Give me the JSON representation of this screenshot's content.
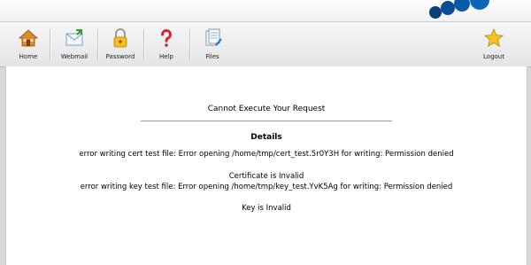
{
  "toolbar": {
    "home_label": "Home",
    "webmail_label": "Webmail",
    "password_label": "Password",
    "help_label": "Help",
    "files_label": "Files",
    "logout_label": "Logout"
  },
  "icons": {
    "home": "house-icon",
    "webmail": "mail-icon",
    "password": "padlock-icon",
    "help": "question-mark-icon",
    "files": "files-icon",
    "logout": "star-icon"
  },
  "colors": {
    "brand_blue": "#0a66b7",
    "content_bg": "#ffffff",
    "toolbar_bg": "#ececec"
  },
  "main": {
    "title": "Cannot Execute Your Request",
    "details_heading": "Details",
    "error_cert": "error writing cert test file: Error opening /home/tmp/cert_test.5r0Y3H for writing: Permission denied",
    "cert_status": "Certificate is Invalid",
    "error_key": "error writing key test file: Error opening /home/tmp/key_test.YvK5Ag for writing: Permission denied",
    "key_status": "Key is Invalid"
  }
}
